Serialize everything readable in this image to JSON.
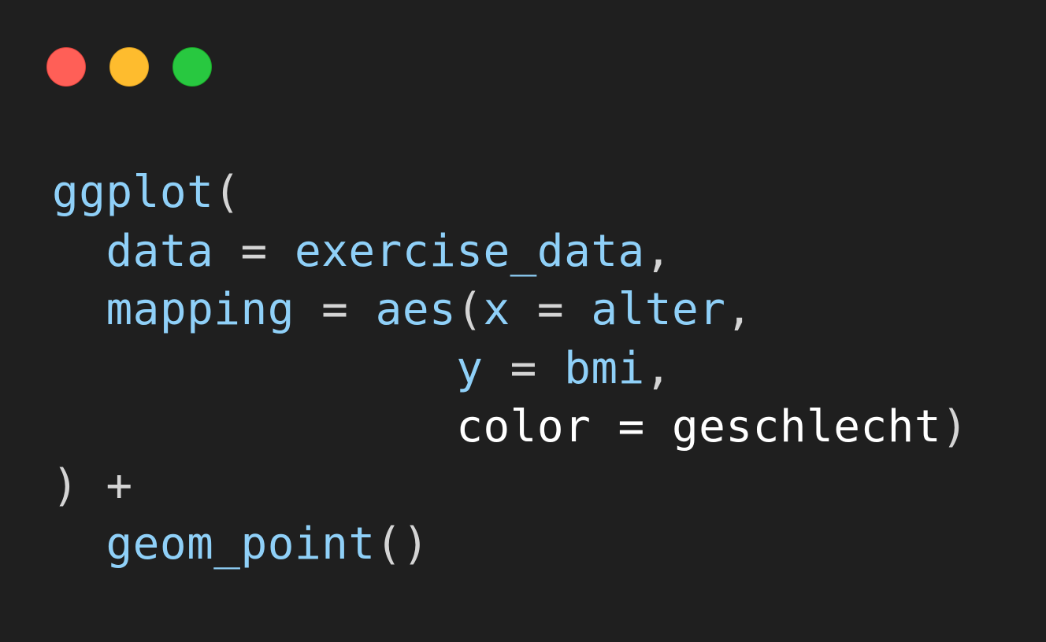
{
  "window": {
    "colors": {
      "background": "#1f1f1f",
      "close": "#ff5f57",
      "minimize": "#febc2e",
      "maximize": "#28c840",
      "identifier": "#8fd0f8",
      "punctuation": "#d4d4d4",
      "plain": "#ffffff"
    }
  },
  "code": {
    "l1": {
      "fn": "ggplot",
      "open": "("
    },
    "l2": {
      "indent": "  ",
      "arg": "data",
      "eq": " = ",
      "val": "exercise_data",
      "comma": ","
    },
    "l3": {
      "indent": "  ",
      "arg": "mapping",
      "eq": " = ",
      "fn": "aes",
      "open": "(",
      "x": "x",
      "eq2": " = ",
      "xval": "alter",
      "comma": ","
    },
    "l4": {
      "indent": "               ",
      "y": "y",
      "eq": " = ",
      "yval": "bmi",
      "comma": ","
    },
    "l5": {
      "indent": "               ",
      "text": "color = geschlecht",
      "close": ")"
    },
    "l6": {
      "close": ")",
      "plus": " +"
    },
    "l7": {
      "indent": "  ",
      "fn": "geom_point",
      "parens": "()"
    }
  }
}
